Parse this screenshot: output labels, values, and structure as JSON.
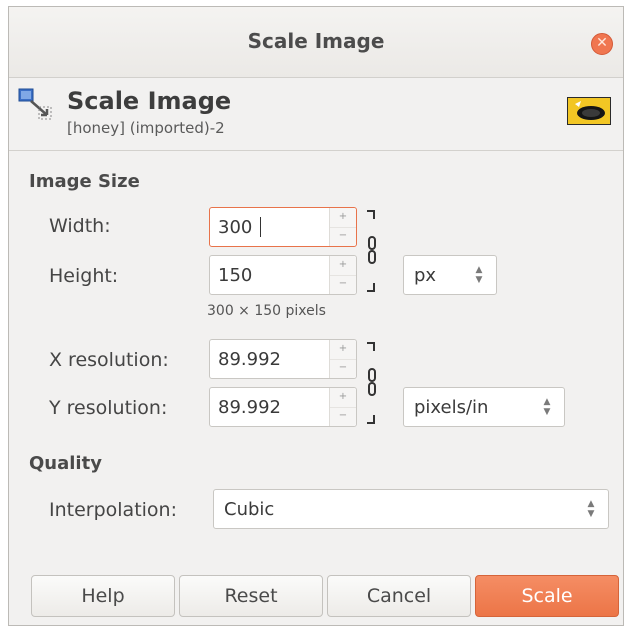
{
  "window": {
    "title": "Scale Image"
  },
  "header": {
    "icon": "scale-image-icon",
    "title": "Scale Image",
    "subtitle": "[honey] (imported)-2",
    "thumbnail": "image-thumbnail"
  },
  "image_size": {
    "section_label": "Image Size",
    "width_label": "Width:",
    "width_value": "300",
    "height_label": "Height:",
    "height_value": "150",
    "size_unit": "px",
    "pixel_summary": "300 × 150 pixels",
    "xres_label": "X resolution:",
    "xres_value": "89.992",
    "yres_label": "Y resolution:",
    "yres_value": "89.992",
    "res_unit": "pixels/in"
  },
  "quality": {
    "section_label": "Quality",
    "interpolation_label": "Interpolation:",
    "interpolation_value": "Cubic"
  },
  "buttons": {
    "help": "Help",
    "reset": "Reset",
    "cancel": "Cancel",
    "scale": "Scale"
  },
  "colors": {
    "accent": "#ec7547",
    "focus_border": "#e8734a",
    "close": "#f07650",
    "window_bg": "#f2f1f0"
  }
}
